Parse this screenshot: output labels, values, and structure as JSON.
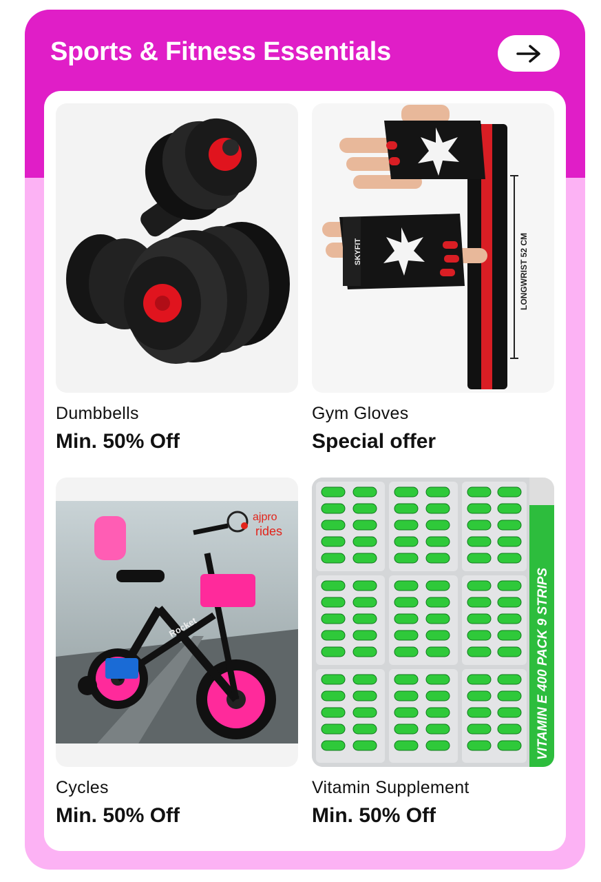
{
  "section": {
    "title": "Sports & Fitness Essentials",
    "arrow_icon": "arrow-right-icon"
  },
  "colors": {
    "header": "#e01ec7",
    "body": "#fcb2f4",
    "accent_pink": "#ff1d8e",
    "vitamin_green": "#2dbd3d"
  },
  "products": [
    {
      "name": "Dumbbells",
      "offer": "Min. 50% Off",
      "image_icon": "dumbbells-image"
    },
    {
      "name": "Gym Gloves",
      "offer": "Special offer",
      "image_icon": "gym-gloves-image",
      "image_text": {
        "strap": "LONGWRIST 52 CM",
        "brand": "SKYFIT"
      }
    },
    {
      "name": "Cycles",
      "offer": "Min. 50% Off",
      "image_icon": "cycle-image",
      "image_text": {
        "logo_top": "ajpro",
        "logo_bottom": "rides",
        "frame": "Rocket"
      }
    },
    {
      "name": "Vitamin Supplement",
      "offer": "Min. 50% Off",
      "image_icon": "vitamin-capsules-image",
      "image_text": {
        "banner": "VITAMIN E 400 PACK 9 STRIPS"
      }
    }
  ]
}
